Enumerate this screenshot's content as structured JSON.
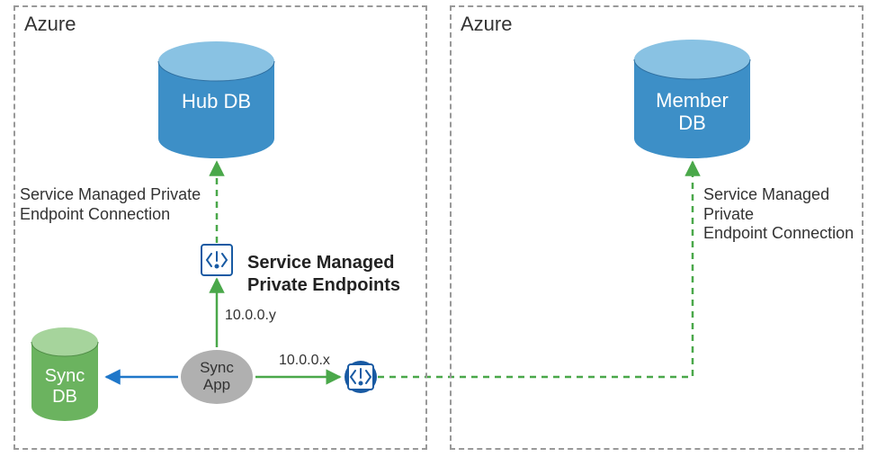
{
  "left_region": {
    "title": "Azure"
  },
  "right_region": {
    "title": "Azure"
  },
  "hub_db": {
    "label": "Hub DB"
  },
  "member_db": {
    "label_line1": "Member",
    "label_line2": "DB"
  },
  "sync_db": {
    "label_line1": "Sync",
    "label_line2": "DB"
  },
  "sync_app": {
    "label_line1": "Sync",
    "label_line2": "App"
  },
  "pe_title": {
    "line1": "Service Managed",
    "line2": "Private Endpoints"
  },
  "conn_label_left": {
    "line1": "Service Managed Private",
    "line2": "Endpoint Connection"
  },
  "conn_label_right": {
    "line1": "Service Managed Private",
    "line2": "Endpoint Connection"
  },
  "ip_y": "10.0.0.y",
  "ip_x": "10.0.0.x",
  "colors": {
    "blue": "#3d8fc7",
    "blue_top": "#89c2e3",
    "green_db": "#6bb35f",
    "green_db_top": "#a6d49c",
    "gray_app": "#b0b0b0",
    "arrow_green": "#4aa84a",
    "arrow_blue": "#1f77c9",
    "pe_bg": "#ffffff",
    "pe_border": "#185aa3",
    "annot": "#333333"
  },
  "chart_data": {
    "type": "diagram",
    "regions": [
      {
        "id": "left",
        "title": "Azure"
      },
      {
        "id": "right",
        "title": "Azure"
      }
    ],
    "nodes": [
      {
        "id": "hub_db",
        "label": "Hub DB",
        "type": "database",
        "region": "left",
        "color": "blue"
      },
      {
        "id": "sync_db",
        "label": "Sync DB",
        "type": "database",
        "region": "left",
        "color": "green"
      },
      {
        "id": "sync_app",
        "label": "Sync App",
        "type": "app",
        "region": "left",
        "color": "gray"
      },
      {
        "id": "pe_y",
        "label": "Private Endpoint",
        "type": "private_endpoint",
        "region": "left",
        "ip": "10.0.0.y"
      },
      {
        "id": "pe_x",
        "label": "Private Endpoint",
        "type": "private_endpoint",
        "region": "left",
        "ip": "10.0.0.x"
      },
      {
        "id": "member_db",
        "label": "Member DB",
        "type": "database",
        "region": "right",
        "color": "blue"
      }
    ],
    "edges": [
      {
        "from": "sync_app",
        "to": "sync_db",
        "style": "solid",
        "color": "blue"
      },
      {
        "from": "sync_app",
        "to": "pe_y",
        "style": "solid",
        "color": "green"
      },
      {
        "from": "pe_y",
        "to": "hub_db",
        "style": "dashed",
        "color": "green",
        "label": "Service Managed Private Endpoint Connection"
      },
      {
        "from": "sync_app",
        "to": "pe_x",
        "style": "solid",
        "color": "green"
      },
      {
        "from": "pe_x",
        "to": "member_db",
        "style": "dashed",
        "color": "green",
        "label": "Service Managed Private Endpoint Connection"
      }
    ],
    "title": "Service Managed Private Endpoints"
  }
}
